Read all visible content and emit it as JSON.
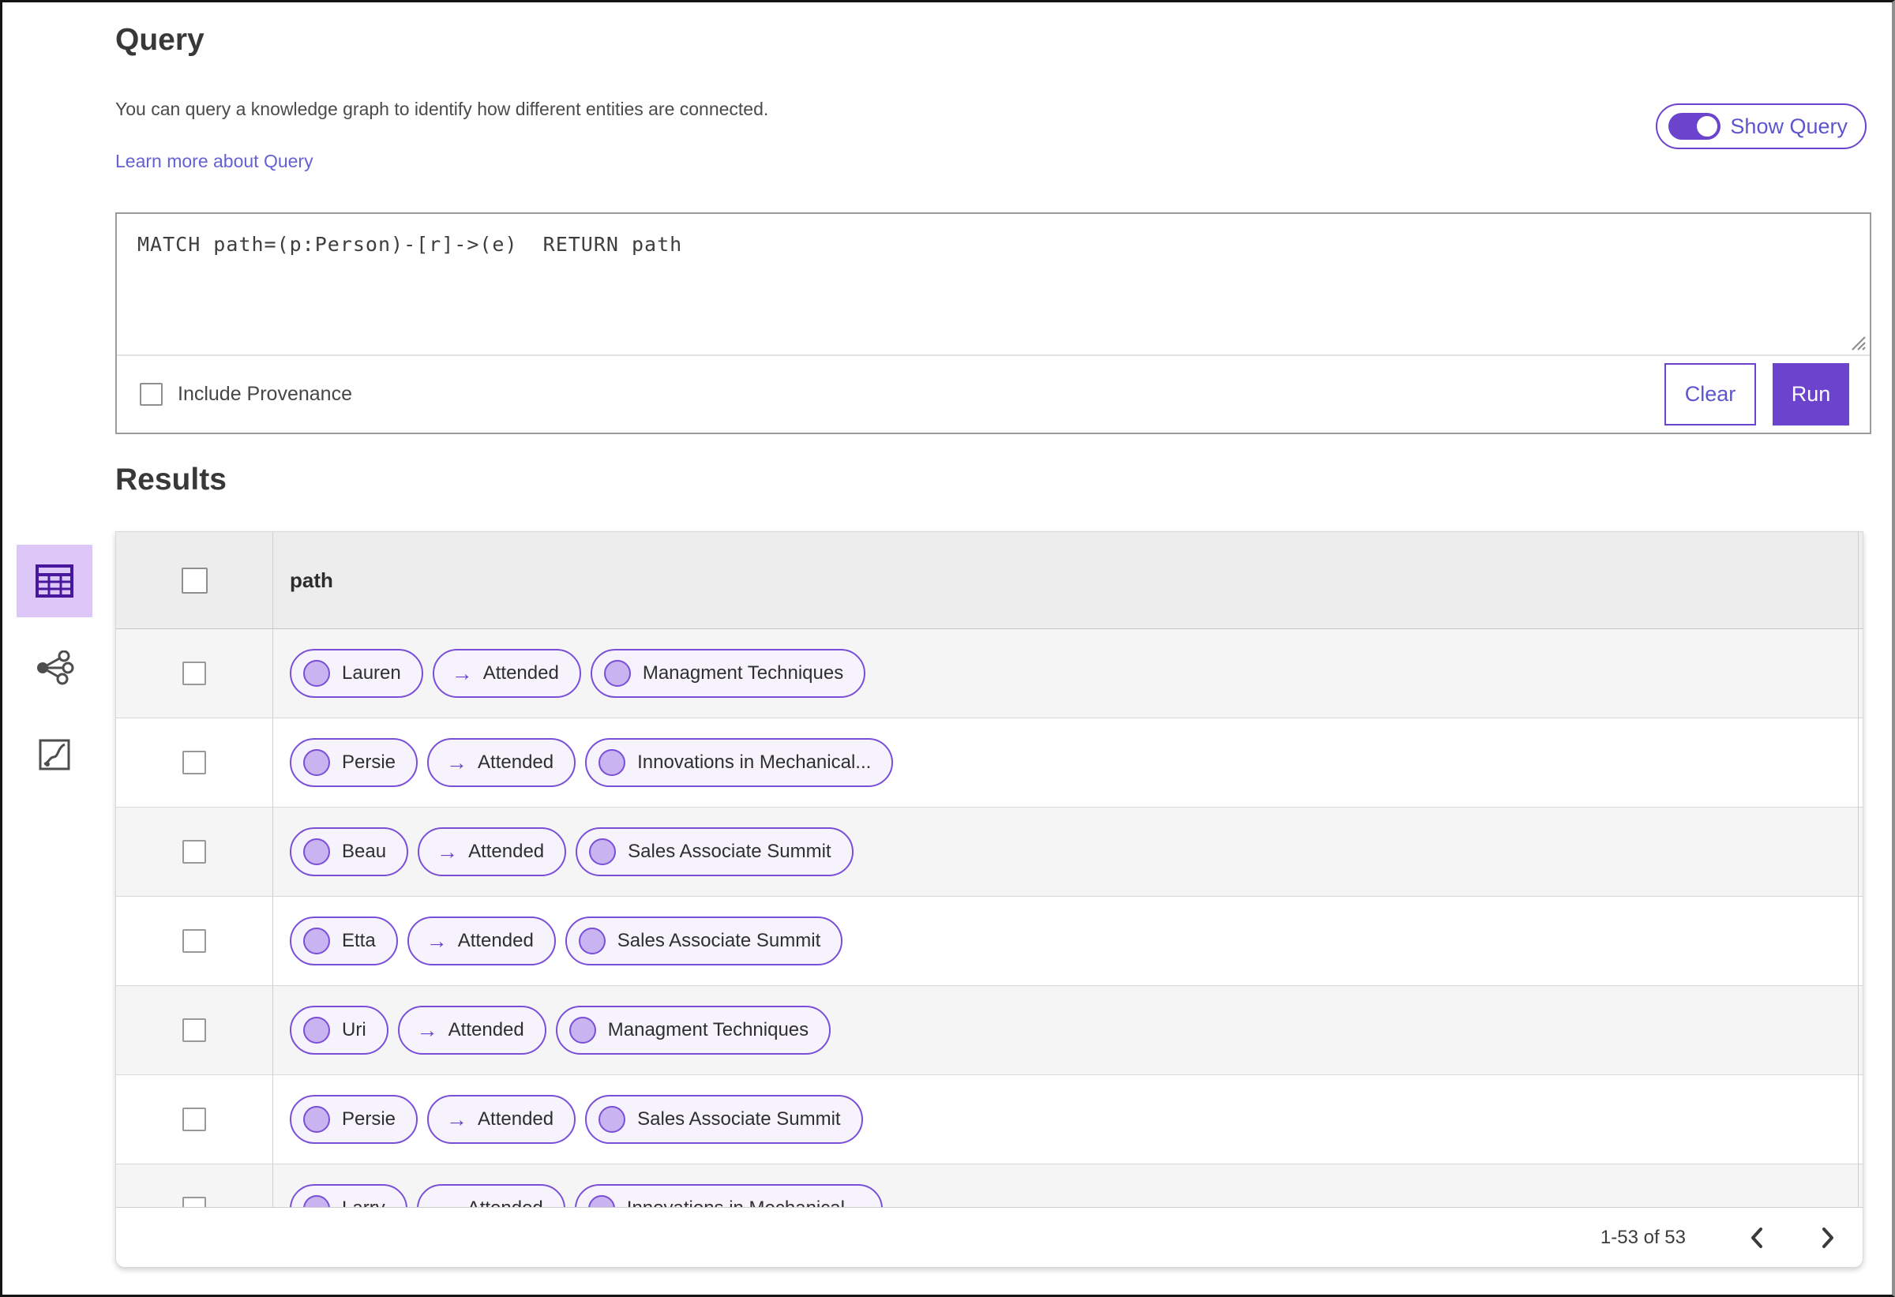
{
  "query_section": {
    "title": "Query",
    "description": "You can query a knowledge graph to identify how different entities are connected.",
    "learn_more_link": "Learn more about Query",
    "show_query_toggle": {
      "label": "Show Query",
      "state": "on"
    },
    "editor_text": "MATCH path=(p:Person)-[r]->(e)  RETURN path",
    "include_provenance_label": "Include Provenance",
    "include_provenance_checked": false,
    "buttons": {
      "clear": "Clear",
      "run": "Run"
    }
  },
  "results_section": {
    "title": "Results",
    "view_switcher": {
      "selected": "table-view",
      "options": [
        "table-view",
        "graph-view",
        "chart-view"
      ]
    },
    "table": {
      "column_header": "path",
      "edge_arrow": "→",
      "rows": [
        {
          "start_node": "Lauren",
          "edge": "Attended",
          "end_node": "Managment Techniques"
        },
        {
          "start_node": "Persie",
          "edge": "Attended",
          "end_node": "Innovations in Mechanical..."
        },
        {
          "start_node": "Beau",
          "edge": "Attended",
          "end_node": "Sales Associate Summit"
        },
        {
          "start_node": "Etta",
          "edge": "Attended",
          "end_node": "Sales Associate Summit"
        },
        {
          "start_node": "Uri",
          "edge": "Attended",
          "end_node": "Managment Techniques"
        },
        {
          "start_node": "Persie",
          "edge": "Attended",
          "end_node": "Sales Associate Summit"
        },
        {
          "start_node": "Larry",
          "edge": "Attended",
          "end_node": "Innovations in Mechanical..."
        }
      ]
    },
    "pagination": {
      "range_label": "1-53 of 53"
    }
  },
  "colors": {
    "accent": "#6b43cd",
    "pill_border": "#7a4fd8",
    "node_fill": "#c9b3f0",
    "selected_tile_bg": "#dcc7f8",
    "link": "#6461d1"
  }
}
